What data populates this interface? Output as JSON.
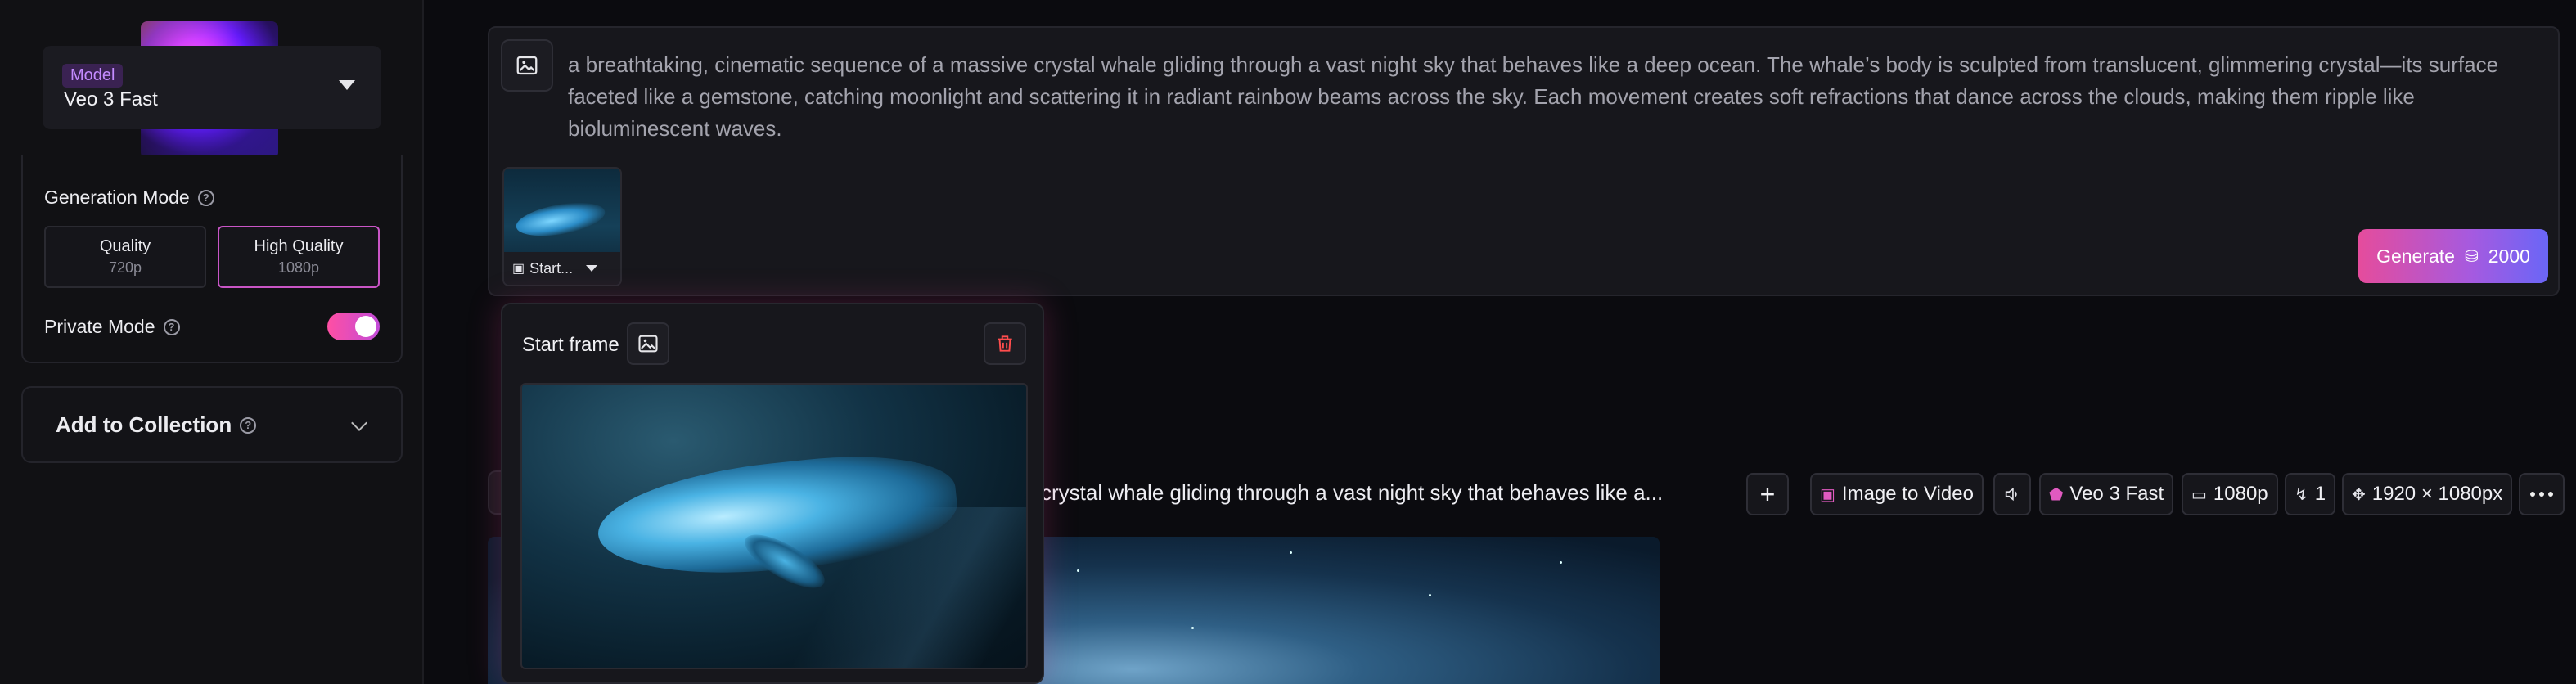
{
  "sidebar": {
    "model": {
      "tag": "Model",
      "name": "Veo 3 Fast"
    },
    "generation_mode": {
      "label": "Generation Mode",
      "options": [
        {
          "title": "Quality",
          "sub": "720p",
          "active": false
        },
        {
          "title": "High Quality",
          "sub": "1080p",
          "active": true
        }
      ]
    },
    "private_mode": {
      "label": "Private Mode",
      "enabled": true
    },
    "collection": {
      "label": "Add to Collection"
    }
  },
  "prompt": {
    "text": "a breathtaking, cinematic sequence of a massive crystal whale gliding through a vast night sky that behaves like a deep ocean. The whale’s body is sculpted from translucent, glimmering crystal—its surface faceted like a gemstone, catching moonlight and scattering it in radiant rainbow beams across the sky. Each movement creates soft refractions that dance across the clouds, making them ripple like bioluminescent waves.",
    "frame_label": "Start...",
    "generate": {
      "label": "Generate",
      "cost": "2000"
    }
  },
  "start_frame_popover": {
    "title": "Start frame"
  },
  "generation": {
    "prompt_excerpt": "crystal whale gliding through a vast night sky that behaves like a...",
    "chips": {
      "mode": "Image to Video",
      "model": "Veo 3 Fast",
      "resolution": "1080p",
      "count": "1",
      "dimensions": "1920 × 1080px"
    }
  },
  "colors": {
    "accent_pink": "#e54c9c",
    "accent_purple": "#6a66f7",
    "active_border": "#c955c6"
  }
}
